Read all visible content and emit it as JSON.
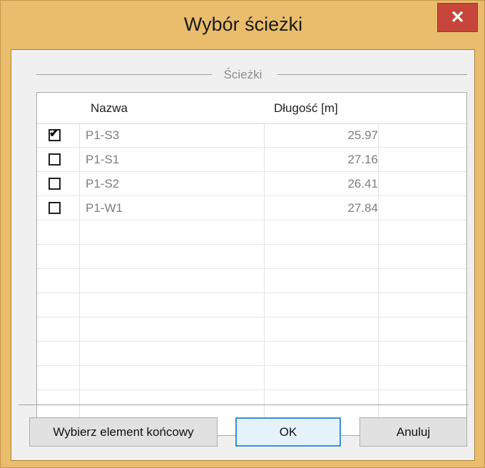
{
  "window": {
    "title": "Wybór ścieżki",
    "close_glyph": "✕"
  },
  "group": {
    "legend": "Ścieżki"
  },
  "table": {
    "columns": [
      "Nazwa",
      "Długość [m]"
    ],
    "rows": [
      {
        "checked": true,
        "name": "P1-S3",
        "length": "25.97"
      },
      {
        "checked": false,
        "name": "P1-S1",
        "length": "27.16"
      },
      {
        "checked": false,
        "name": "P1-S2",
        "length": "26.41"
      },
      {
        "checked": false,
        "name": "P1-W1",
        "length": "27.84"
      }
    ],
    "empty_rows": 7
  },
  "buttons": {
    "select_end": "Wybierz element końcowy",
    "ok": "OK",
    "cancel": "Anuluj"
  }
}
